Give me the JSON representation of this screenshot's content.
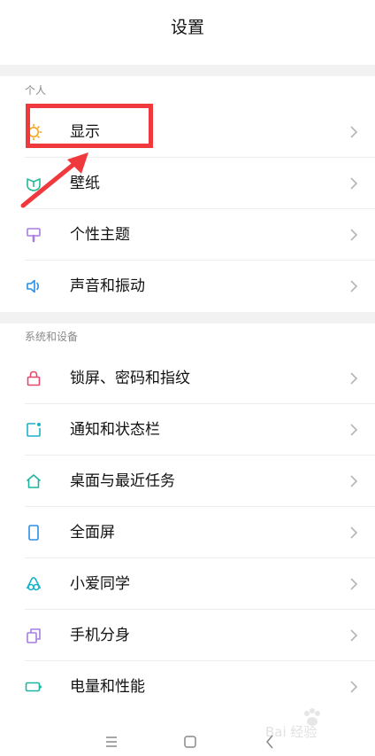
{
  "header": {
    "title": "设置"
  },
  "sections": [
    {
      "label": "个人",
      "items": [
        {
          "label": "显示",
          "icon": "display-sun-icon",
          "color": "#f5a623"
        },
        {
          "label": "壁纸",
          "icon": "wallpaper-leaf-icon",
          "color": "#26b99a"
        },
        {
          "label": "个性主题",
          "icon": "theme-brush-icon",
          "color": "#a97de0"
        },
        {
          "label": "声音和振动",
          "icon": "speaker-icon",
          "color": "#2a8fe5"
        }
      ]
    },
    {
      "label": "系统和设备",
      "items": [
        {
          "label": "锁屏、密码和指纹",
          "icon": "lock-icon",
          "color": "#e5486b"
        },
        {
          "label": "通知和状态栏",
          "icon": "notification-icon",
          "color": "#19b3c8"
        },
        {
          "label": "桌面与最近任务",
          "icon": "home-icon",
          "color": "#1fb4a0"
        },
        {
          "label": "全面屏",
          "icon": "phone-screen-icon",
          "color": "#2a8fe5"
        },
        {
          "label": "小爱同学",
          "icon": "xiaoai-icon",
          "color": "#19b3c8"
        },
        {
          "label": "手机分身",
          "icon": "dual-apps-icon",
          "color": "#a97de0"
        },
        {
          "label": "电量和性能",
          "icon": "battery-icon",
          "color": "#1fb4a0"
        }
      ]
    }
  ],
  "annotation": {
    "highlight_color": "#f0393c"
  },
  "watermark": {
    "text": "Bai 经验"
  },
  "navbar": {
    "icons": [
      "menu-icon",
      "home-square-icon",
      "back-icon"
    ]
  }
}
